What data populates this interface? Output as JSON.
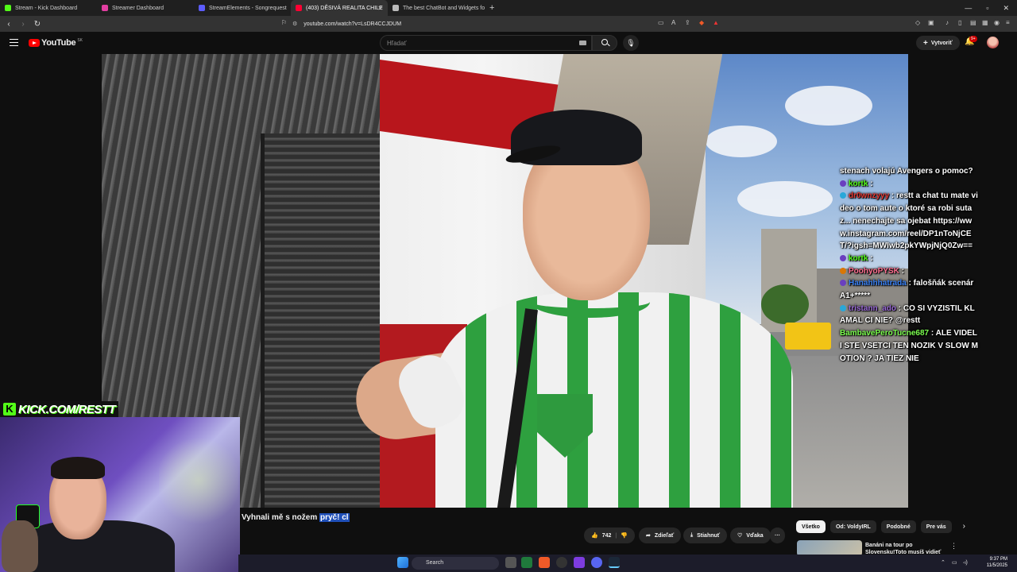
{
  "browser": {
    "tabs": [
      {
        "label": "Stream - Kick Dashboard",
        "color": "#53fc18"
      },
      {
        "label": "Streamer Dashboard",
        "color": "#e13ea1"
      },
      {
        "label": "StreamElements - Songrequest",
        "color": "#5d5dff"
      },
      {
        "label": "(403) DĚSIVÁ REALITA CHILE",
        "color": "#ff0033",
        "active": true
      },
      {
        "label": "The best ChatBot and Widgets for K",
        "color": "#bbbbbb"
      }
    ],
    "url": "youtube.com/watch?v=LsDR4CCJDUM"
  },
  "youtube": {
    "logo_text": "YouTube",
    "country_code": "SK",
    "search_placeholder": "Hľadať",
    "create_label": "Vytvoriť",
    "notif_badge": "9+",
    "video_title": "Vyhnali mě s nožem",
    "video_title_highlight": "pryč! cl",
    "actions": {
      "likes": "742",
      "share": "Zdieľať",
      "download": "Stiahnuť",
      "thanks": "Vďaka",
      "more": "···"
    },
    "chips": [
      "Všetko",
      "Od: VoldyIRL",
      "Podobné",
      "Pre vás"
    ],
    "suggestion": {
      "title": "Banáni na tour po Slovensku!Toto musíš vidieť"
    }
  },
  "chat": [
    {
      "user": "",
      "user_color": "#ffffff",
      "text": "stenach volajú Avengers o pomoc?",
      "badge": ""
    },
    {
      "user": "kortk",
      "user_color": "#53fc18",
      "text": ":",
      "badge": "#6a3fbf"
    },
    {
      "user": "dr0wnzyyy",
      "user_color": "#e53935",
      "text": ": restt a chat tu mate video o tom aute o ktoré sa robi sutaz... nenechajte sa ojebat https://www.instagram.com/reel/DP1nToNjCET/?igsh=MWIwb2pkYWpjNjQ0Zw==",
      "badge": "#2aa7d8"
    },
    {
      "user": "kortk",
      "user_color": "#53fc18",
      "text": ":",
      "badge": "#6a3fbf"
    },
    {
      "user": "PoohyoPYSK",
      "user_color": "#ff6f91",
      "text": ":",
      "badge": "#d97706"
    },
    {
      "user": "Hanahhhatrada",
      "user_color": "#3b82f6",
      "text": ": falošňák scenár A1+*****",
      "badge": "#6a3fbf"
    },
    {
      "user": "tristann_ado",
      "user_color": "#9b6bd8",
      "text": ": CO SI VYZISTIL KLAMAL CI NIE? @restt",
      "badge": "#2aa7d8"
    },
    {
      "user": "BambavePeroTucne687",
      "user_color": "#7cff4f",
      "text": ": ALE VIDELI STE VSETCI TEN NOZIK V SLOW MOTION ? JA TIEZ NIE",
      "badge": ""
    }
  ],
  "overlay": {
    "kick_text": "KICK.COM/RESTT",
    "kick_letter": "K"
  },
  "taskbar": {
    "search_label": "Search",
    "time": "9:37 PM",
    "date": "11/5/2025"
  }
}
